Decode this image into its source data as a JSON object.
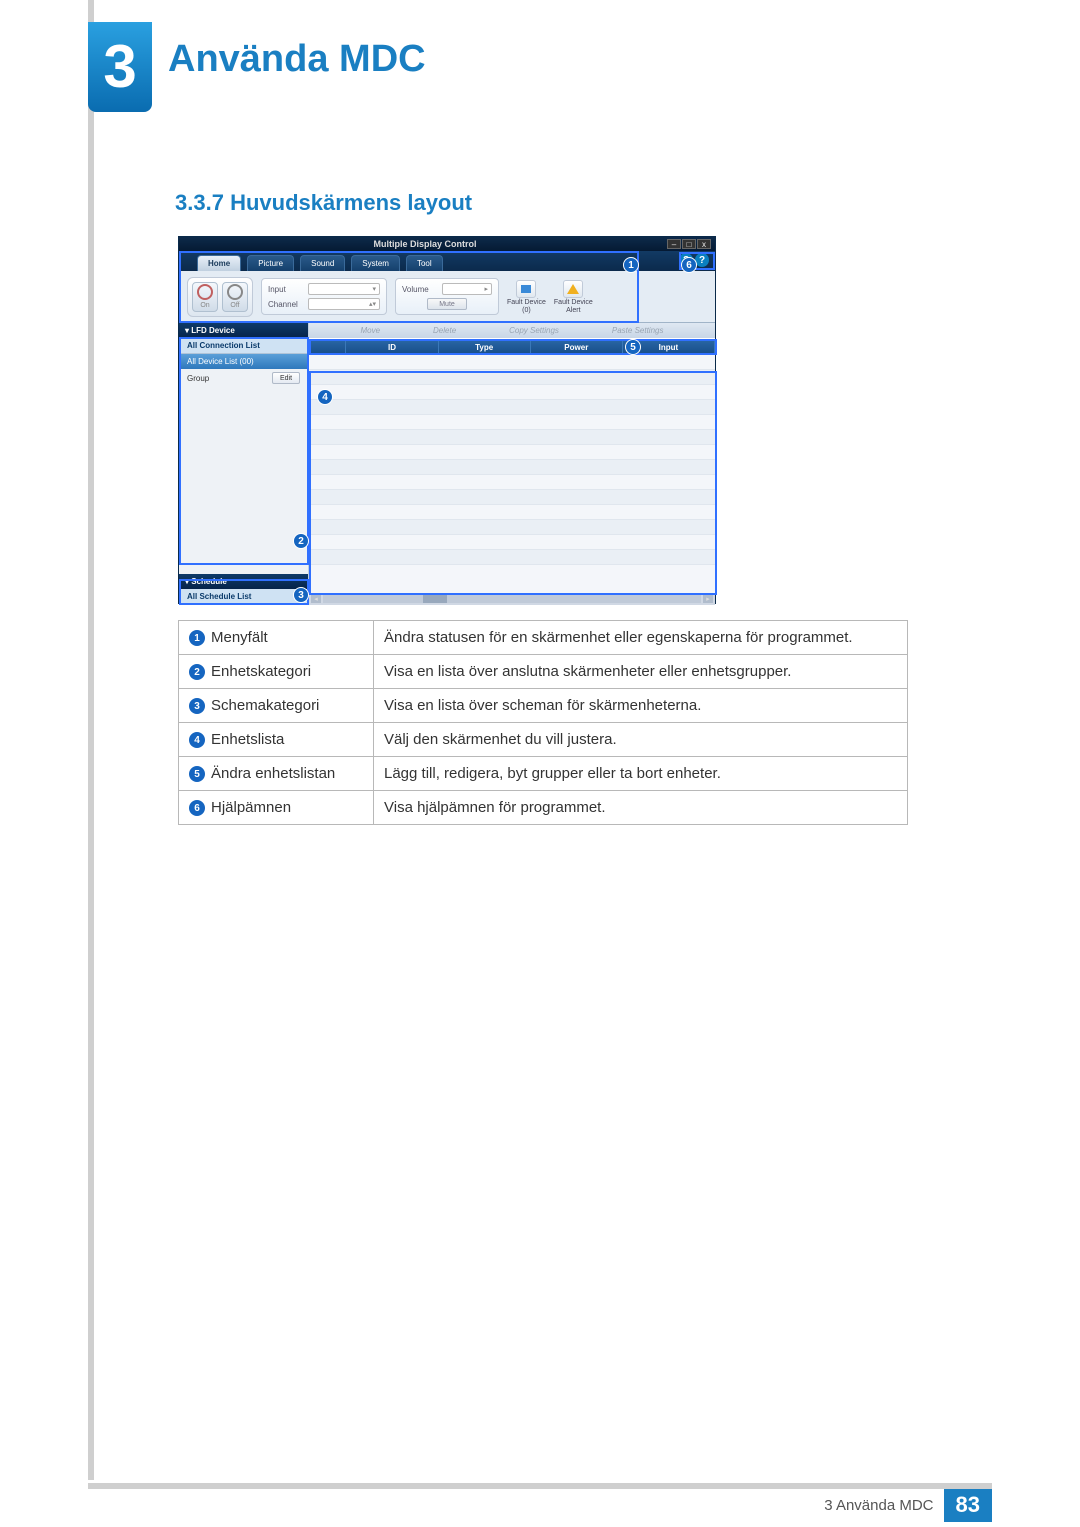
{
  "chapter": {
    "number": "3",
    "title": "Använda MDC"
  },
  "section": {
    "number": "3.3.7",
    "title": "Huvudskärmens layout"
  },
  "app": {
    "window_title": "Multiple Display Control",
    "win_buttons": {
      "min": "–",
      "max": "□",
      "close": "x"
    },
    "tabs": [
      "Home",
      "Picture",
      "Sound",
      "System",
      "Tool"
    ],
    "help_icons": [
      "?",
      "?"
    ],
    "power": {
      "on": "On",
      "off": "Off"
    },
    "input_group": {
      "input_label": "Input",
      "channel_label": "Channel"
    },
    "volume_group": {
      "volume_label": "Volume",
      "mute_label": "Mute"
    },
    "fault": [
      {
        "label_top": "Fault Device",
        "label_bottom": "(0)"
      },
      {
        "label_top": "Fault Device",
        "label_bottom": "Alert"
      }
    ],
    "side": {
      "lfd_header": "▾  LFD Device",
      "all_conn": "All Connection List",
      "all_dev": "All Device List (00)",
      "group_label": "Group",
      "edit_label": "Edit",
      "schedule_header": "▾  Schedule",
      "all_sched": "All Schedule List"
    },
    "actions": [
      "Move",
      "Delete",
      "Copy Settings",
      "Paste Settings"
    ],
    "grid_headers": [
      "",
      "ID",
      "Type",
      "Power",
      "Input"
    ]
  },
  "annotations": [
    "1",
    "2",
    "3",
    "4",
    "5",
    "6"
  ],
  "legend": [
    {
      "num": "1",
      "name": "Menyfält",
      "desc": "Ändra statusen för en skärmenhet eller egenskaperna för programmet."
    },
    {
      "num": "2",
      "name": "Enhetskategori",
      "desc": "Visa en lista över anslutna skärmenheter eller enhetsgrupper."
    },
    {
      "num": "3",
      "name": "Schemakategori",
      "desc": "Visa en lista över scheman för skärmenheterna."
    },
    {
      "num": "4",
      "name": "Enhetslista",
      "desc": "Välj den skärmenhet du vill justera."
    },
    {
      "num": "5",
      "name": "Ändra enhetslistan",
      "desc": "Lägg till, redigera, byt grupper eller ta bort enheter."
    },
    {
      "num": "6",
      "name": "Hjälpämnen",
      "desc": "Visa hjälpämnen för programmet."
    }
  ],
  "footer": {
    "label": "3 Använda MDC",
    "page": "83"
  }
}
